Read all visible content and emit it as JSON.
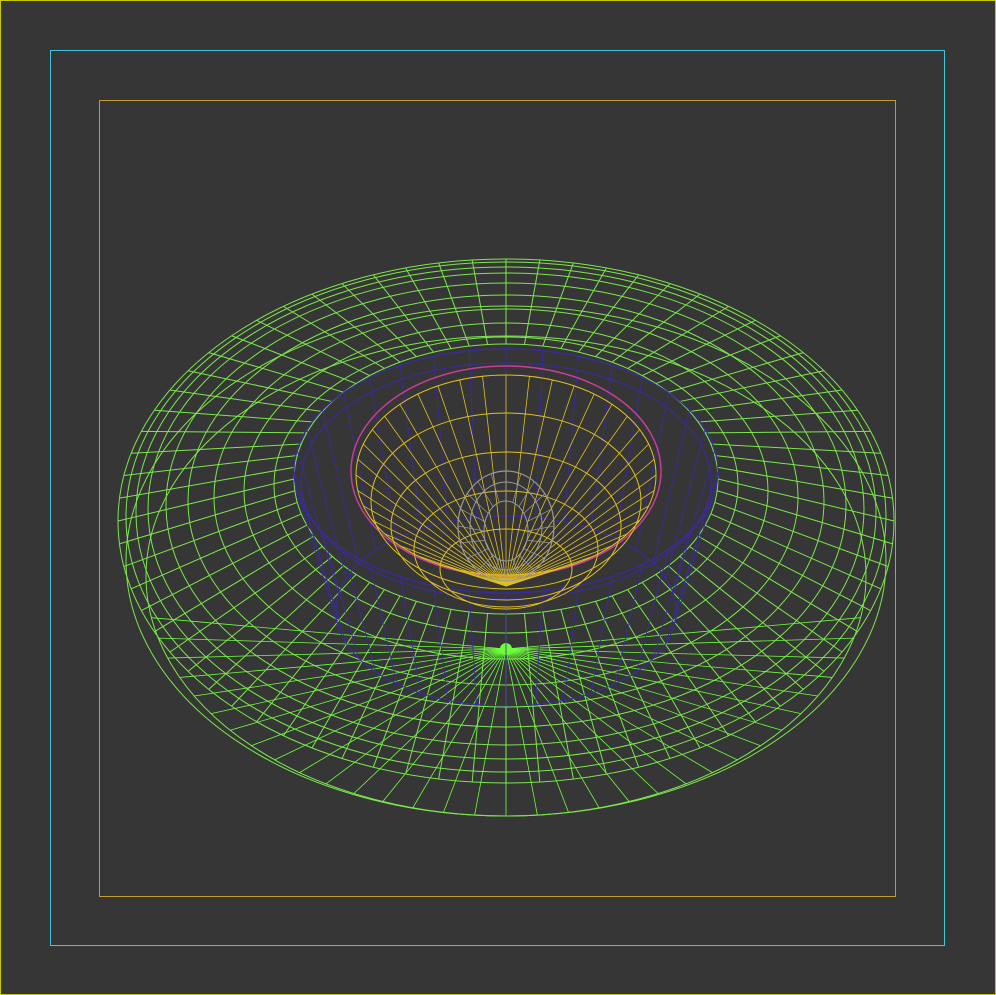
{
  "viewport": {
    "background": "#363636",
    "border_color": "#c8c800",
    "safe_frame_outer_color": "#3fc6d8",
    "safe_frame_inner_color": "#c79a2e"
  },
  "scene": {
    "object_type": "wireframe-mesh",
    "description_icon": "cup-and-saucer-wireframe",
    "colors": {
      "saucer": "#7be84a",
      "saucer_bright": "#6dff3a",
      "cup_outer": "#3a2aa8",
      "cup_inner": "#e0c020",
      "cup_rim": "#c83c9a",
      "handle": "#9a9a9a"
    }
  }
}
